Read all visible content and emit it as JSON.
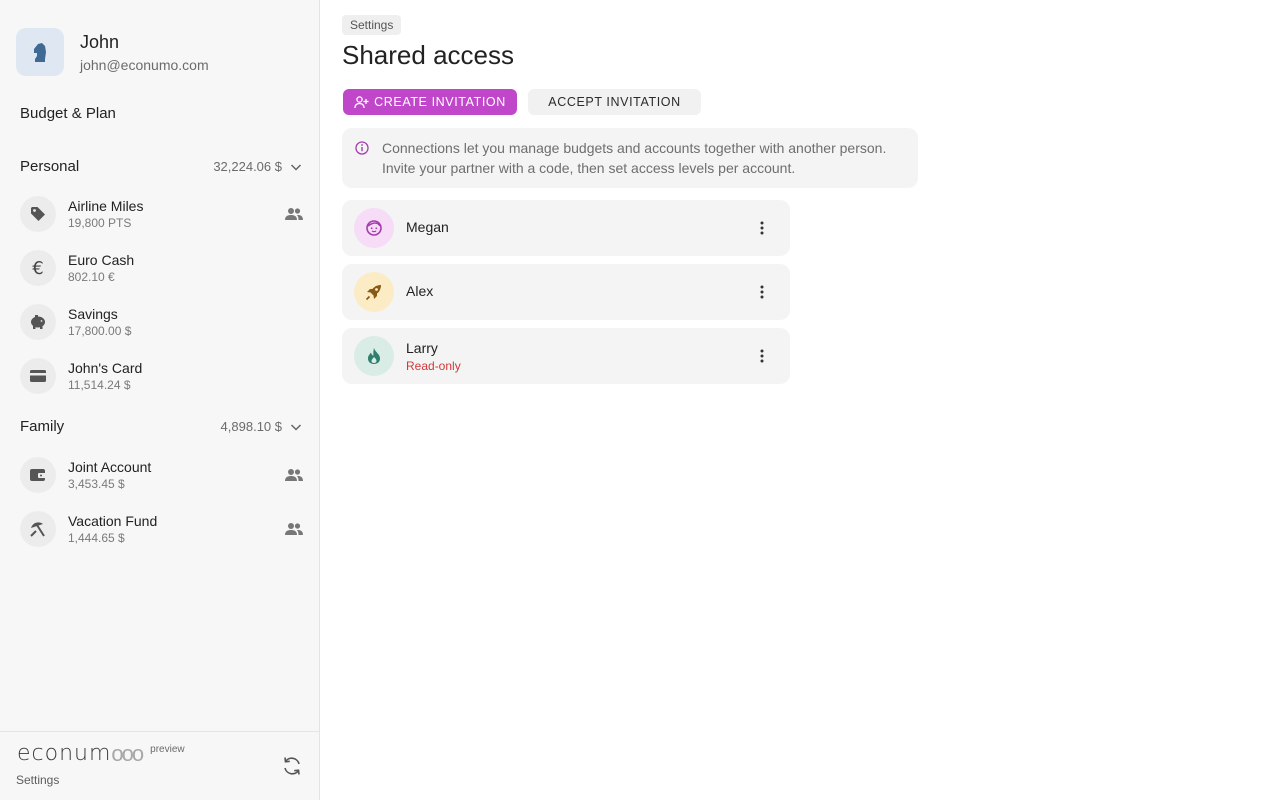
{
  "user": {
    "name": "John",
    "email": "john@econumo.com"
  },
  "sidebar": {
    "budget_link": "Budget & Plan",
    "folders": [
      {
        "name": "Personal",
        "total": "32,224.06 $",
        "accounts": [
          {
            "name": "Airline Miles",
            "balance": "19,800 PTS",
            "icon": "tag-icon",
            "shared": true
          },
          {
            "name": "Euro Cash",
            "balance": "802.10 €",
            "icon": "euro-icon",
            "shared": false
          },
          {
            "name": "Savings",
            "balance": "17,800.00 $",
            "icon": "piggy-bank-icon",
            "shared": false
          },
          {
            "name": "John's Card",
            "balance": "11,514.24 $",
            "icon": "credit-card-icon",
            "shared": false
          }
        ]
      },
      {
        "name": "Family",
        "total": "4,898.10 $",
        "accounts": [
          {
            "name": "Joint Account",
            "balance": "3,453.45 $",
            "icon": "wallet-icon",
            "shared": true
          },
          {
            "name": "Vacation Fund",
            "balance": "1,444.65 $",
            "icon": "beach-umbrella-icon",
            "shared": true
          }
        ]
      }
    ],
    "footer": {
      "logo_main": "econum",
      "logo_ooo": "ooo",
      "logo_badge": "preview",
      "settings_label": "Settings"
    }
  },
  "main": {
    "breadcrumb": "Settings",
    "title": "Shared access",
    "create_button": "CREATE INVITATION",
    "accept_button": "ACCEPT INVITATION",
    "info": {
      "line1": "Connections let you manage budgets and accounts together with another person.",
      "line2": "Invite your partner with a code, then set access levels per account."
    },
    "connections": [
      {
        "name": "Megan",
        "role": "",
        "avatar_icon": "face-icon",
        "avatar_bg": "#f6dcf6",
        "avatar_color": "#a43cae"
      },
      {
        "name": "Alex",
        "role": "",
        "avatar_icon": "rocket-icon",
        "avatar_bg": "#fbecc6",
        "avatar_color": "#8a5a12"
      },
      {
        "name": "Larry",
        "role": "Read-only",
        "avatar_icon": "fire-icon",
        "avatar_bg": "#d9ece6",
        "avatar_color": "#2e7f6b"
      }
    ]
  },
  "colors": {
    "accent": "#c047c9",
    "danger": "#d1393a",
    "sidebar_bg": "#f7f7f7"
  }
}
